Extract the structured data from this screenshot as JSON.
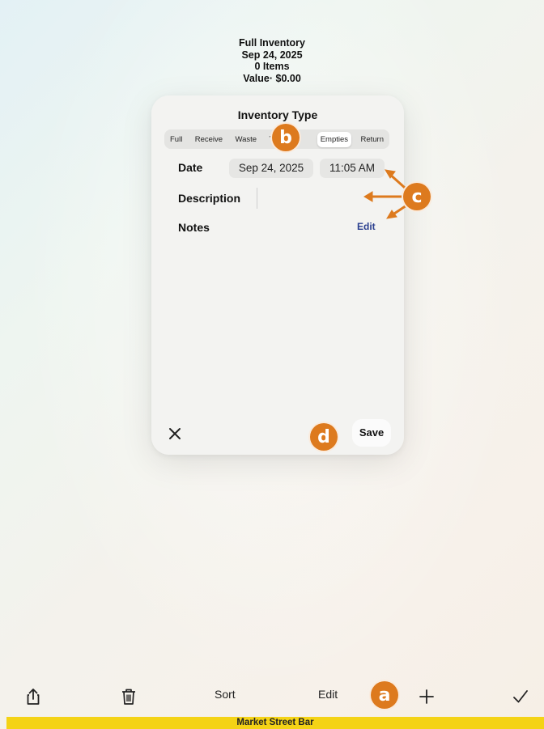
{
  "header": {
    "title": "Full Inventory",
    "date": "Sep 24, 2025",
    "items": "0 Items",
    "value": "Value· $0.00"
  },
  "sheet": {
    "title": "Inventory Type",
    "types": [
      "Full",
      "Receive",
      "Waste",
      "T",
      "Empties",
      "Return"
    ],
    "date_label": "Date",
    "date_value": "Sep 24, 2025",
    "time_value": "11:05 AM",
    "description_label": "Description",
    "description_value": "",
    "notes_label": "Notes",
    "edit_label": "Edit",
    "save_label": "Save"
  },
  "annotations": {
    "a": "a",
    "b": "b",
    "c": "c",
    "d": "d"
  },
  "annotation_color": "#dd7a1e",
  "toolbar": {
    "sort_label": "Sort",
    "edit_label": "Edit",
    "icons": [
      "share-icon",
      "trash-icon",
      "plus-icon",
      "checkmark-icon"
    ]
  },
  "footer": {
    "venue": "Market Street Bar",
    "color": "#f4d316"
  }
}
